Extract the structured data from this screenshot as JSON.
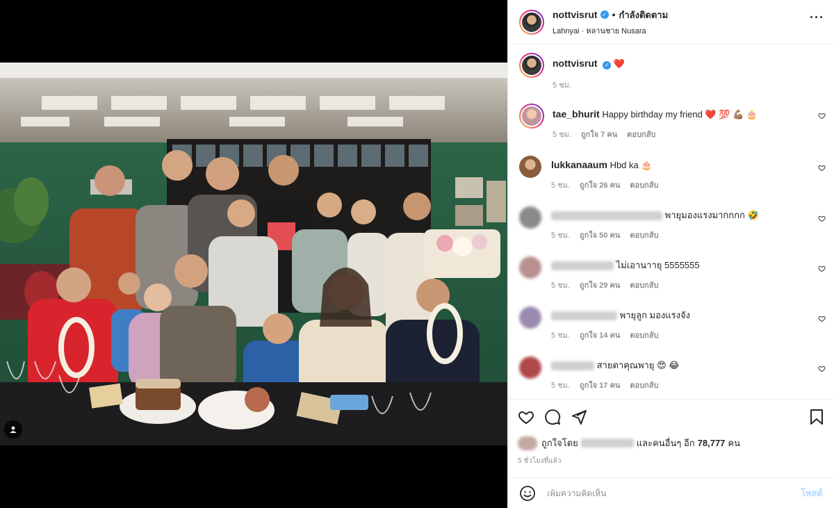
{
  "post": {
    "username": "nottvisrut",
    "follow_label": "กำลังติดตาม",
    "location": "Lahnyai · หลานชาย Nusara",
    "more_icon": "more-horizontal-icon"
  },
  "caption": {
    "username": "nottvisrut",
    "text": "❤️",
    "time": "5 ชม."
  },
  "comments": [
    {
      "username": "tae_bhurit",
      "text": "Happy birthday my friend ❤️ 💯 💪🏽 🎂",
      "time": "5 ชม.",
      "likes": "ถูกใจ 7 คน",
      "reply": "ตอบกลับ"
    },
    {
      "username": "lukkanaaum",
      "text": "Hbd ka 🎂",
      "time": "5 ชม.",
      "likes": "ถูกใจ 26 คน",
      "reply": "ตอบกลับ"
    },
    {
      "username": "",
      "text": "พายุมองแรงมากกกก 🤣",
      "time": "5 ชม.",
      "likes": "ถูกใจ 50 คน",
      "reply": "ตอบกลับ"
    },
    {
      "username": "",
      "text": "ไม่เอานาายุ 5555555",
      "time": "5 ชม.",
      "likes": "ถูกใจ 29 คน",
      "reply": "ตอบกลับ"
    },
    {
      "username": "",
      "text": "พายุลูก มองแรงจัง",
      "time": "5 ชม.",
      "likes": "ถูกใจ 14 คน",
      "reply": "ตอบกลับ"
    },
    {
      "username": "",
      "text": "สายตาคุณพายุ 😍 😂",
      "time": "5 ชม.",
      "likes": "ถูกใจ 17 คน",
      "reply": "ตอบกลับ"
    }
  ],
  "actions": {
    "liked_by_prefix": "ถูกใจโดย",
    "liked_by_suffix": "และคนอื่นๆ อีก",
    "like_count": "78,777",
    "like_unit": "คน",
    "time_ago": "5 ชั่วโมงที่แล้ว"
  },
  "composer": {
    "placeholder": "เพิ่มความคิดเห็น",
    "post_label": "โพสต์"
  },
  "colors": {
    "accent": "#3897f0",
    "heart": "#ed4956",
    "post_disabled": "#b3dbff"
  }
}
